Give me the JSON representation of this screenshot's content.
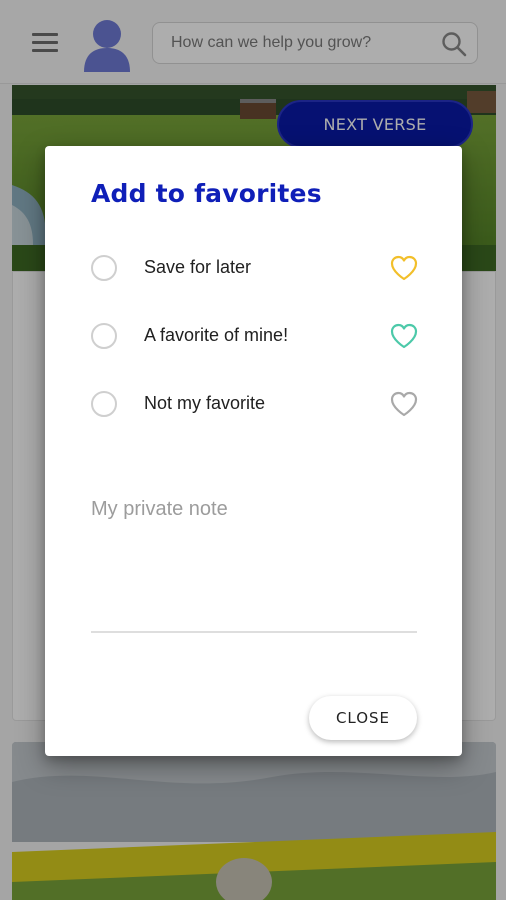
{
  "header": {
    "search": {
      "placeholder": "How can we help you grow?"
    }
  },
  "feed": {
    "next_button_label": "NEXT VERSE"
  },
  "dialog": {
    "title": "Add to favorites",
    "options": [
      {
        "label": "Save for later",
        "heart_color": "#f2bf2a",
        "selected": false
      },
      {
        "label": "A favorite of mine!",
        "heart_color": "#4cc9a9",
        "selected": false
      },
      {
        "label": "Not my favorite",
        "heart_color": "#a9a9a9",
        "selected": false
      }
    ],
    "note": {
      "placeholder": "My private note",
      "value": ""
    },
    "close_label": "CLOSE"
  },
  "colors": {
    "title": "#0f1fb8",
    "primary_button": "#0a1aa8",
    "avatar": "#6f7bd6"
  }
}
